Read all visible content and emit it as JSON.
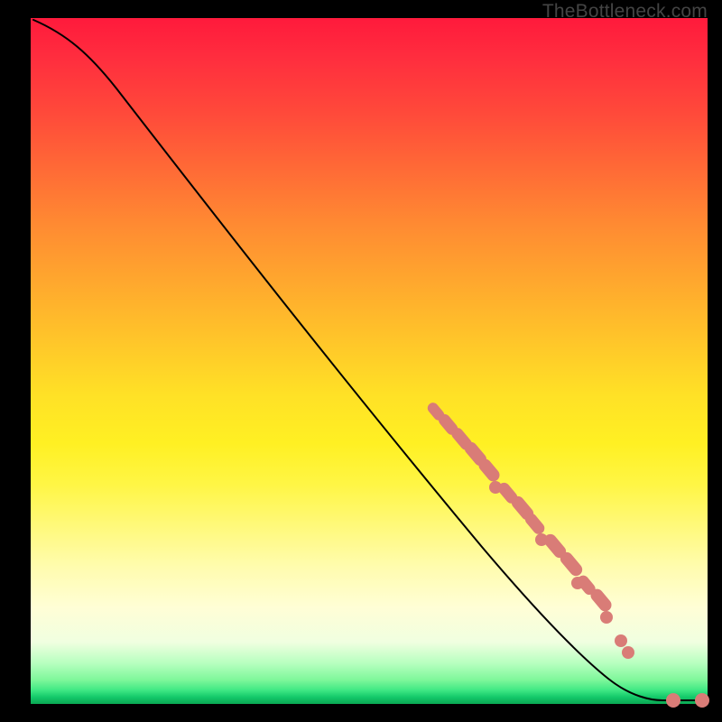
{
  "watermark": "TheBottleneck.com",
  "colors": {
    "dot": "#d97c77",
    "curve": "#000000"
  },
  "chart_data": {
    "type": "line",
    "title": "",
    "xlabel": "",
    "ylabel": "",
    "xlim": [
      0,
      100
    ],
    "ylim": [
      0,
      100
    ],
    "grid": false,
    "legend": false,
    "series": [
      {
        "name": "bottleneck-curve",
        "x": [
          0,
          3,
          7,
          12,
          18,
          25,
          33,
          42,
          52,
          62,
          70,
          78,
          84,
          88,
          92,
          95,
          98,
          100
        ],
        "y": [
          100,
          98,
          95,
          90,
          84,
          76,
          68,
          58,
          48,
          38,
          30,
          22,
          16,
          12,
          8,
          5,
          2,
          1
        ]
      }
    ],
    "clusters": [
      {
        "name": "mid-diagonal-cluster",
        "x_range": [
          60,
          84
        ],
        "y_range": [
          16,
          44
        ],
        "note": "dense salmon dots along the curve"
      },
      {
        "name": "bottom-right-cluster",
        "x_range": [
          94,
          100
        ],
        "y_range": [
          0,
          2
        ],
        "note": "two salmon dots connected by a short horizontal segment"
      }
    ]
  }
}
